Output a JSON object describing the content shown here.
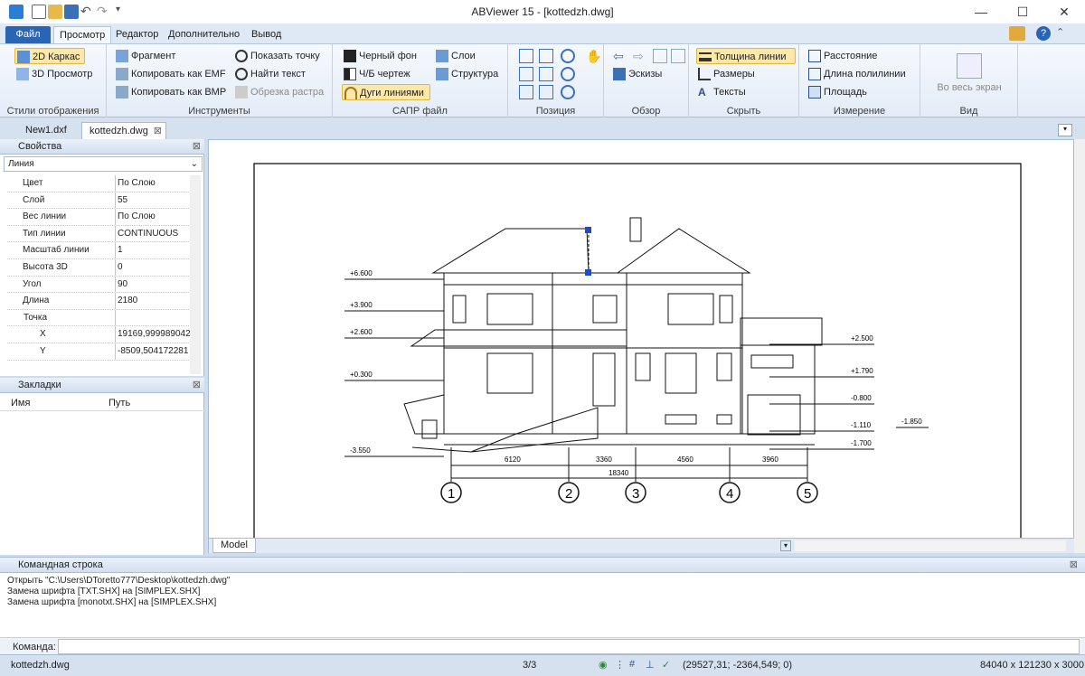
{
  "window": {
    "title": "ABViewer 15 - [kottedzh.dwg]",
    "min": "—",
    "max": "☐",
    "close": "✕"
  },
  "tabs": {
    "file": "Файл",
    "items": [
      "Просмотр",
      "Редактор",
      "Дополнительно",
      "Вывод"
    ]
  },
  "ribbon": {
    "styles": {
      "title": "Стили отображения",
      "wire": "2D Каркас",
      "view3d": "3D Просмотр"
    },
    "tools": {
      "title": "Инструменты",
      "fragment": "Фрагмент",
      "copy_emf": "Копировать как EMF",
      "copy_bmp": "Копировать как BMP",
      "show_point": "Показать точку",
      "find_text": "Найти текст",
      "clip_raster": "Обрезка растра"
    },
    "cad": {
      "title": "САПР файл",
      "black_bg": "Черный фон",
      "bw": "Ч/Б чертеж",
      "arcs": "Дуги линиями",
      "layers": "Слои",
      "structure": "Структура"
    },
    "position": {
      "title": "Позиция"
    },
    "review": {
      "title": "Обзор",
      "sketches": "Эскизы"
    },
    "hide": {
      "title": "Скрыть",
      "line_width": "Толщина линии",
      "dims": "Размеры",
      "texts": "Тексты"
    },
    "measure": {
      "title": "Измерение",
      "distance": "Расстояние",
      "polyline": "Длина полилинии",
      "area": "Площадь"
    },
    "view": {
      "title": "Вид",
      "fullscreen": "Во весь экран"
    }
  },
  "doc_tabs": [
    "New1.dxf",
    "kottedzh.dwg"
  ],
  "properties": {
    "title": "Свойства",
    "type": "Линия",
    "rows": [
      {
        "k": "Цвет",
        "v": "По Слою"
      },
      {
        "k": "Слой",
        "v": "55"
      },
      {
        "k": "Вес линии",
        "v": "По Слою"
      },
      {
        "k": "Тип линии",
        "v": "CONTINUOUS"
      },
      {
        "k": "Масштаб линии",
        "v": "1"
      },
      {
        "k": "Высота 3D",
        "v": "0"
      },
      {
        "k": "Угол",
        "v": "90"
      },
      {
        "k": "Длина",
        "v": "2180"
      },
      {
        "k": "Точка",
        "v": ""
      },
      {
        "k": "X",
        "v": "19169,999989042"
      },
      {
        "k": "Y",
        "v": "-8509,504172281"
      }
    ]
  },
  "bookmarks": {
    "title": "Закладки",
    "col_name": "Имя",
    "col_path": "Путь"
  },
  "drawing": {
    "tab": "Model",
    "levels": [
      "+6.600",
      "+3.900",
      "+2.600",
      "+0.300",
      "-3.550"
    ],
    "right_levels": [
      "+2.500",
      "+1.790",
      "-0.800",
      "-1.110",
      "-1.700",
      "-1.850"
    ],
    "dims": [
      "6120",
      "3360",
      "4560",
      "3960"
    ],
    "total": "18340",
    "axes": [
      "1",
      "2",
      "3",
      "4",
      "5"
    ]
  },
  "command": {
    "title": "Командная строка",
    "lines": [
      "Открыть \"C:\\Users\\DToretto777\\Desktop\\kottedzh.dwg\"",
      "Замена шрифта [TXT.SHX] на [SIMPLEX.SHX]",
      "Замена шрифта [monotxt.SHX] на [SIMPLEX.SHX]"
    ],
    "label": "Команда:"
  },
  "status": {
    "file": "kottedzh.dwg",
    "page": "3/3",
    "coords": "(29527,31; -2364,549; 0)",
    "size": "84040 x 121230 x 3000"
  }
}
